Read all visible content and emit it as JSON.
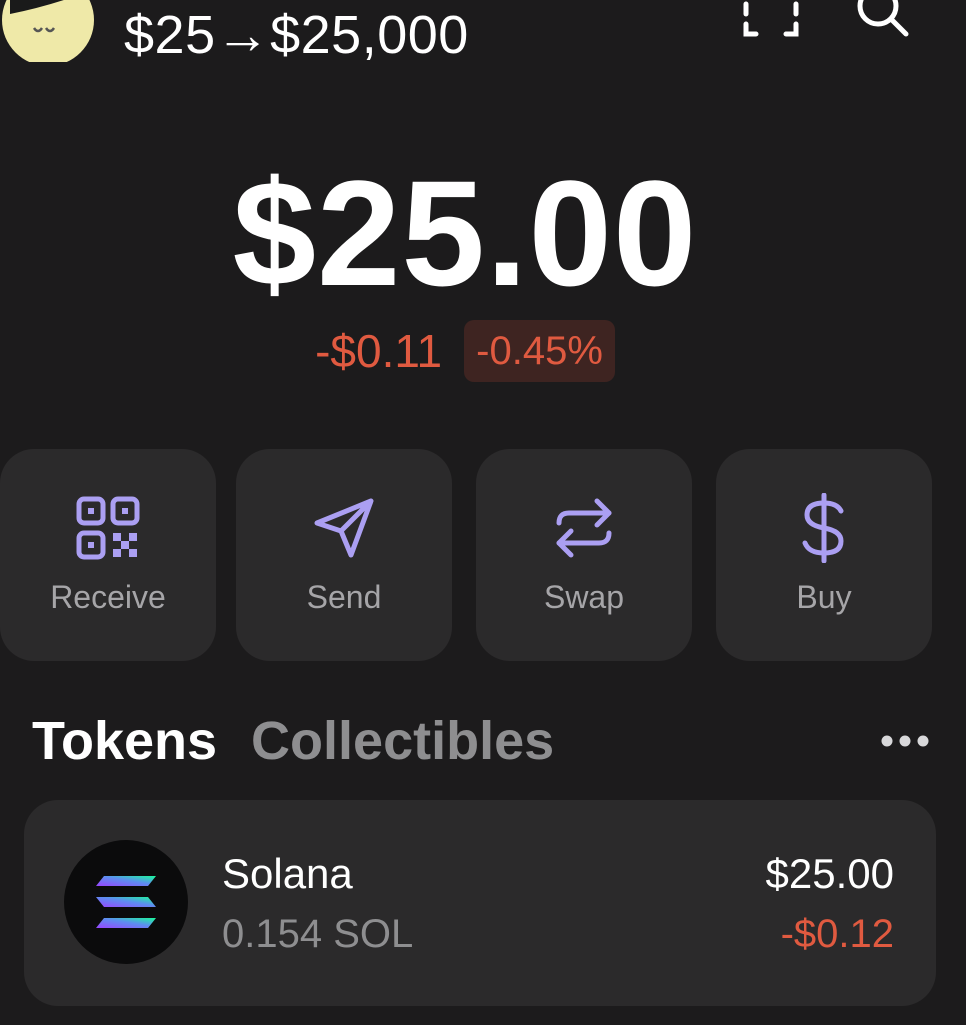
{
  "header": {
    "account_name": "$25→$25,000",
    "avatar_icon": "avatar-icon",
    "scan_icon": "scan-icon",
    "search_icon": "search-icon"
  },
  "balance": {
    "total": "$25.00",
    "change_amount": "-$0.11",
    "change_percent": "-0.45%"
  },
  "actions": [
    {
      "label": "Receive",
      "icon": "qr-code-icon"
    },
    {
      "label": "Send",
      "icon": "send-icon"
    },
    {
      "label": "Swap",
      "icon": "swap-icon"
    },
    {
      "label": "Buy",
      "icon": "dollar-icon"
    }
  ],
  "tabs": {
    "tokens": "Tokens",
    "collectibles": "Collectibles",
    "more_icon": "more-icon"
  },
  "tokens": [
    {
      "name": "Solana",
      "amount": "0.154 SOL",
      "value": "$25.00",
      "change": "-$0.12",
      "icon": "solana-logo-icon"
    }
  ],
  "colors": {
    "background": "#1c1b1c",
    "card": "#2b2a2b",
    "accent_purple": "#ab9ff2",
    "negative_red": "#e05a40",
    "muted_text": "#8e8e90"
  }
}
